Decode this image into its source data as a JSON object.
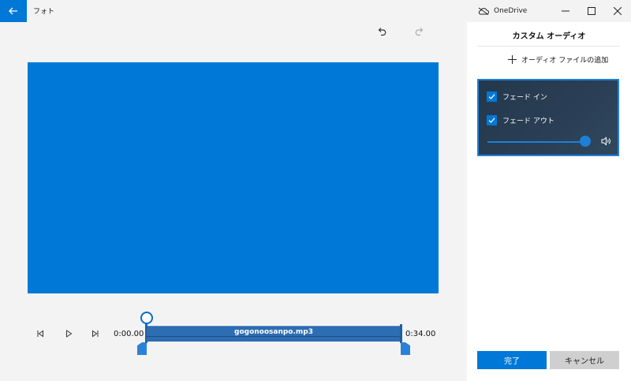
{
  "app": {
    "title": "フォト"
  },
  "titlebar": {
    "onedrive_label": "OneDrive"
  },
  "preview": {
    "color": "#0078d7"
  },
  "playback": {
    "time_start": "0:00.00",
    "time_end": "0:34.00"
  },
  "track": {
    "filename": "gogonoosanpo.mp3"
  },
  "panel": {
    "title": "カスタム オーディオ",
    "add_audio_label": "オーディオ ファイルの追加",
    "fade_in_label": "フェード イン",
    "fade_in_checked": true,
    "fade_out_label": "フェード アウト",
    "fade_out_checked": true,
    "volume_level": 1.0,
    "done_label": "完了",
    "cancel_label": "キャンセル"
  },
  "colors": {
    "accent": "#0078d7",
    "panel_box": "#2a3f55",
    "cancel_bg": "#cfcfcf"
  },
  "icons": [
    "back-arrow-icon",
    "onedrive-icon",
    "minimize-icon",
    "maximize-icon",
    "close-icon",
    "undo-icon",
    "redo-icon",
    "previous-frame-icon",
    "play-icon",
    "next-frame-icon",
    "plus-icon",
    "checkmark-icon",
    "volume-icon"
  ]
}
